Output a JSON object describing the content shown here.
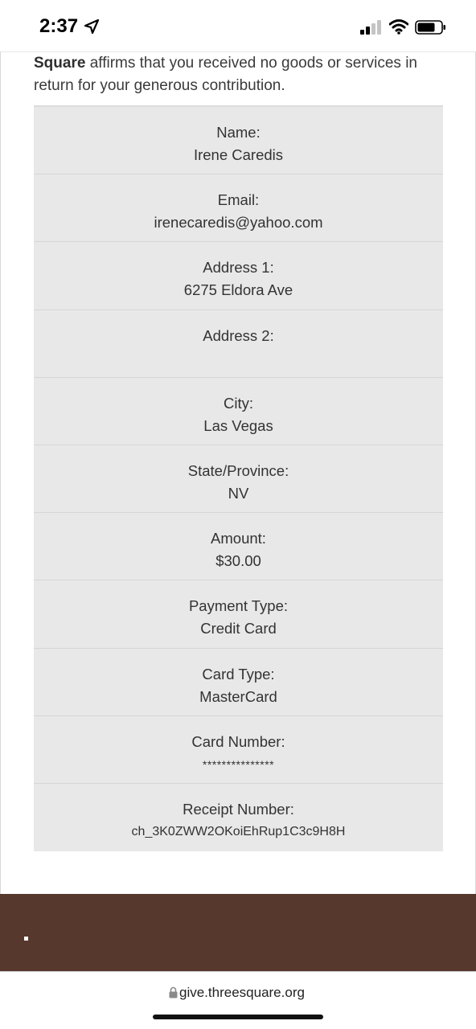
{
  "status_bar": {
    "time": "2:37"
  },
  "intro": {
    "brand": "Square",
    "text": " affirms that you received no goods or services in return for your generous contribution."
  },
  "receipt": {
    "rows": [
      {
        "label": "Name:",
        "value": "Irene Caredis"
      },
      {
        "label": "Email:",
        "value": "irenecaredis@yahoo.com"
      },
      {
        "label": "Address 1:",
        "value": "6275 Eldora Ave"
      },
      {
        "label": "Address 2:",
        "value": ""
      },
      {
        "label": "City:",
        "value": "Las Vegas"
      },
      {
        "label": "State/Province:",
        "value": "NV"
      },
      {
        "label": "Amount:",
        "value": "$30.00"
      },
      {
        "label": "Payment Type:",
        "value": "Credit Card"
      },
      {
        "label": "Card Type:",
        "value": "MasterCard"
      },
      {
        "label": "Card Number:",
        "value": "***************"
      },
      {
        "label": "Receipt Number:",
        "value": "ch_3K0ZWW2OKoiEhRup1C3c9H8H"
      }
    ]
  },
  "browser": {
    "url": "give.threesquare.org"
  },
  "colors": {
    "footer": "#57382d",
    "table_bg": "#e8e8e8"
  }
}
